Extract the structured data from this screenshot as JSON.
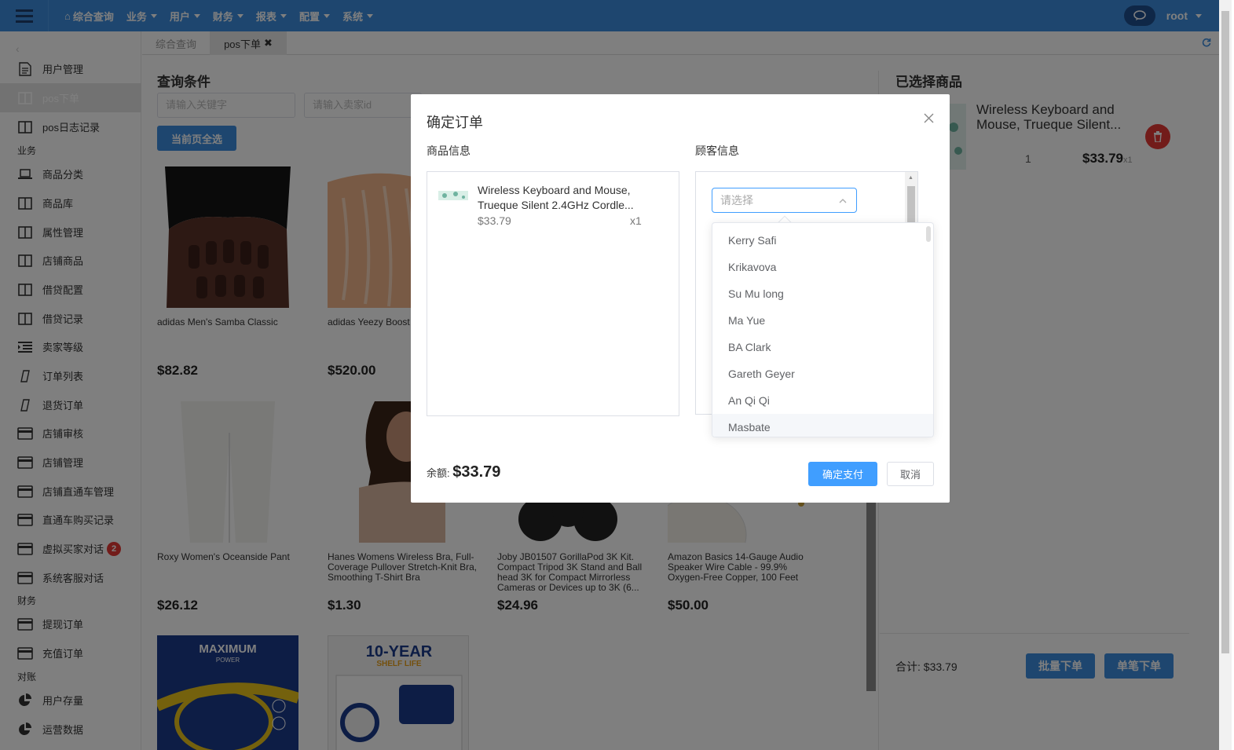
{
  "topbar": {
    "nav": [
      {
        "label": "综合查询",
        "icon": "home-icon"
      },
      {
        "label": "业务"
      },
      {
        "label": "用户"
      },
      {
        "label": "财务"
      },
      {
        "label": "报表"
      },
      {
        "label": "配置"
      },
      {
        "label": "系统"
      }
    ],
    "user": "root"
  },
  "sidebar": {
    "items": [
      "用户管理",
      "pos下单",
      "pos日志记录",
      "商品分类",
      "商品库",
      "属性管理",
      "店铺商品",
      "借贷配置",
      "借贷记录",
      "卖家等级",
      "订单列表",
      "退货订单",
      "店铺审核",
      "店铺管理",
      "店铺直通车管理",
      "直通车购买记录",
      "虚拟买家对话",
      "系统客服对话",
      "提现订单",
      "充值订单",
      "用户存量",
      "运营数据"
    ],
    "groups": [
      "业务",
      "财务",
      "对账"
    ],
    "badge": "2"
  },
  "tabs": [
    "综合查询",
    "pos下单"
  ],
  "query": {
    "title": "查询条件",
    "keyword_placeholder": "请输入关键字",
    "seller_placeholder": "请输入卖家id",
    "select_all": "当前页全选"
  },
  "products": [
    {
      "name": "adidas Men's Samba Classic",
      "price": "$82.82"
    },
    {
      "name": "adidas Yeezy Boost",
      "price": "$520.00"
    },
    {
      "name": "Roxy Women's Oceanside Pant",
      "price": "$26.12"
    },
    {
      "name": "Hanes Womens Wireless Bra, Full-Coverage Pullover Stretch-Knit Bra, Smoothing T-Shirt Bra",
      "price": "$1.30"
    },
    {
      "name": "Joby JB01507 GorillaPod 3K Kit. Compact Tripod 3K Stand and Ball head 3K for Compact Mirrorless Cameras or Devices up to 3K (6...",
      "price": "$24.96"
    },
    {
      "name": "Amazon Basics 14-Gauge Audio Speaker Wire Cable - 99.9% Oxygen-Free Copper, 100 Feet",
      "price": "$50.00"
    },
    {
      "name": "",
      "price": "",
      "img_text1": "MAXIMUM",
      "img_text2": "POWER"
    },
    {
      "name": "",
      "price": "",
      "img_text1": "10-YEAR",
      "img_text2": "SHELF LIFE"
    }
  ],
  "selected": {
    "title": "已选择商品",
    "item_name": "Wireless Keyboard and Mouse, Trueque Silent...",
    "qty": "1",
    "price": "$33.79",
    "qty_suffix": "x1",
    "total": "合计:  $33.79",
    "batch_btn": "批量下单",
    "single_btn": "单笔下单"
  },
  "modal": {
    "title": "确定订单",
    "goods_label": "商品信息",
    "customer_label": "顾客信息",
    "goods": {
      "name": "Wireless Keyboard and Mouse, Trueque Silent 2.4GHz Cordle...",
      "price": "$33.79",
      "qty": "x1"
    },
    "select_placeholder": "请选择",
    "options": [
      "Kerry Safi",
      "Krikavova",
      "Su Mu long",
      "Ma Yue",
      "BA Clark",
      "Gareth Geyer",
      "An Qi Qi",
      "Masbate"
    ],
    "balance_label": "余额:",
    "balance": "$33.79",
    "pay": "确定支付",
    "cancel": "取消"
  }
}
